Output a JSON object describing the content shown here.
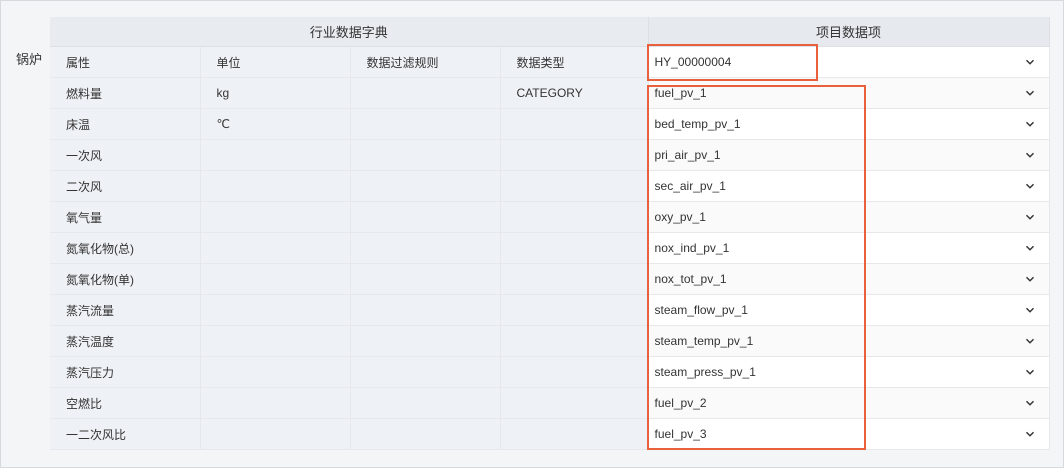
{
  "section_label": "锅炉",
  "group_headers": {
    "dict": "行业数据字典",
    "project": "项目数据项"
  },
  "columns": {
    "attr": "属性",
    "unit": "单位",
    "filter": "数据过滤规则",
    "type": "数据类型"
  },
  "header_select_value": "HY_00000004",
  "rows": [
    {
      "attr": "燃料量",
      "unit": "kg",
      "filter": "",
      "type": "CATEGORY",
      "value": "fuel_pv_1"
    },
    {
      "attr": "床温",
      "unit": "℃",
      "filter": "",
      "type": "",
      "value": "bed_temp_pv_1"
    },
    {
      "attr": "一次风",
      "unit": "",
      "filter": "",
      "type": "",
      "value": "pri_air_pv_1"
    },
    {
      "attr": "二次风",
      "unit": "",
      "filter": "",
      "type": "",
      "value": "sec_air_pv_1"
    },
    {
      "attr": "氧气量",
      "unit": "",
      "filter": "",
      "type": "",
      "value": "oxy_pv_1"
    },
    {
      "attr": "氮氧化物(总)",
      "unit": "",
      "filter": "",
      "type": "",
      "value": "nox_ind_pv_1"
    },
    {
      "attr": "氮氧化物(单)",
      "unit": "",
      "filter": "",
      "type": "",
      "value": "nox_tot_pv_1"
    },
    {
      "attr": "蒸汽流量",
      "unit": "",
      "filter": "",
      "type": "",
      "value": "steam_flow_pv_1"
    },
    {
      "attr": "蒸汽温度",
      "unit": "",
      "filter": "",
      "type": "",
      "value": "steam_temp_pv_1"
    },
    {
      "attr": "蒸汽压力",
      "unit": "",
      "filter": "",
      "type": "",
      "value": "steam_press_pv_1"
    },
    {
      "attr": "空燃比",
      "unit": "",
      "filter": "",
      "type": "",
      "value": "fuel_pv_2"
    },
    {
      "attr": "一二次风比",
      "unit": "",
      "filter": "",
      "type": "",
      "value": "fuel_pv_3"
    }
  ],
  "icons": {
    "dropdown": "chevron-down-icon"
  },
  "colors": {
    "highlight": "#e8603c"
  }
}
